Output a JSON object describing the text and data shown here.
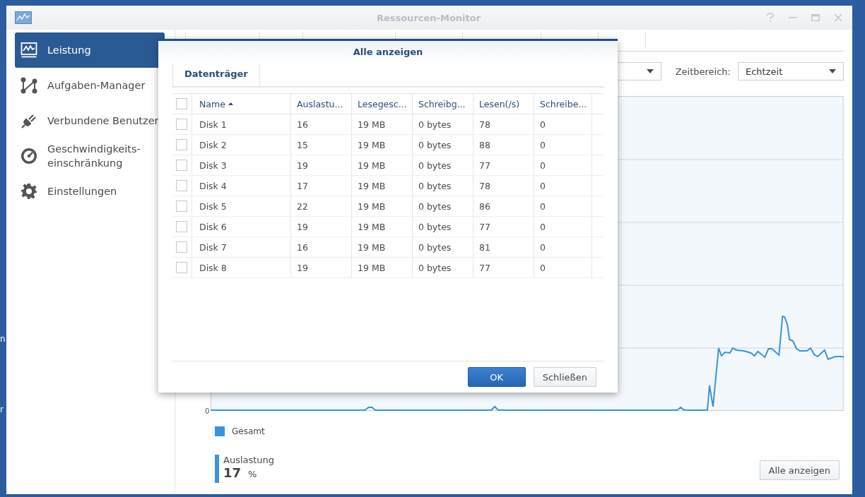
{
  "desktop": {
    "labels": [
      "n",
      "r"
    ]
  },
  "window": {
    "title": "Ressourcen-Monitor"
  },
  "sidebar": {
    "items": [
      {
        "label": "Leistung",
        "selected": true
      },
      {
        "label": "Aufgaben-Manager",
        "selected": false
      },
      {
        "label": "Verbundene Benutzer",
        "selected": false
      },
      {
        "label": "Geschwindigkeits-\neinschränkung",
        "selected": false
      },
      {
        "label": "Einstellungen",
        "selected": false
      }
    ]
  },
  "filters": {
    "time_range_label": "Zeitbereich:",
    "time_range_value": "Echtzeit"
  },
  "chart": {
    "y_label": "0",
    "legend": "Gesamt"
  },
  "usage": {
    "label": "Auslastung",
    "value": "17",
    "unit": "%"
  },
  "show_all_button": "Alle anzeigen",
  "dialog": {
    "title": "Alle anzeigen",
    "tabs": [
      {
        "label": "Datenträger",
        "selected": true
      }
    ],
    "table": {
      "all_checked": false,
      "columns": [
        {
          "label": "Name",
          "sorted": true
        },
        {
          "label": "Auslastu...",
          "sorted": false
        },
        {
          "label": "Lesegesc...",
          "sorted": false
        },
        {
          "label": "Schreibg...",
          "sorted": false
        },
        {
          "label": "Lesen(/s)",
          "sorted": false
        },
        {
          "label": "Schreibe...",
          "sorted": false
        }
      ],
      "rows": [
        {
          "checked": false,
          "cells": [
            "Disk 1",
            "16",
            "19 MB",
            "0 bytes",
            "78",
            "0"
          ]
        },
        {
          "checked": false,
          "cells": [
            "Disk 2",
            "15",
            "19 MB",
            "0 bytes",
            "88",
            "0"
          ]
        },
        {
          "checked": false,
          "cells": [
            "Disk 3",
            "19",
            "19 MB",
            "0 bytes",
            "77",
            "0"
          ]
        },
        {
          "checked": false,
          "cells": [
            "Disk 4",
            "17",
            "19 MB",
            "0 bytes",
            "78",
            "0"
          ]
        },
        {
          "checked": false,
          "cells": [
            "Disk 5",
            "22",
            "19 MB",
            "0 bytes",
            "86",
            "0"
          ]
        },
        {
          "checked": false,
          "cells": [
            "Disk 6",
            "19",
            "19 MB",
            "0 bytes",
            "77",
            "0"
          ]
        },
        {
          "checked": false,
          "cells": [
            "Disk 7",
            "16",
            "19 MB",
            "0 bytes",
            "81",
            "0"
          ]
        },
        {
          "checked": false,
          "cells": [
            "Disk 8",
            "19",
            "19 MB",
            "0 bytes",
            "77",
            "0"
          ]
        }
      ]
    },
    "buttons": [
      {
        "label": "OK",
        "kind": "primary"
      },
      {
        "label": "Schließen",
        "kind": "secondary"
      }
    ]
  }
}
